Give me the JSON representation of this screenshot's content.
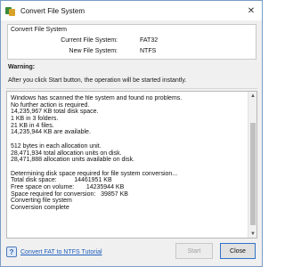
{
  "window": {
    "title": "Convert File System",
    "close_glyph": "✕"
  },
  "info_group": {
    "legend": "Convert File System",
    "rows": [
      {
        "label": "Current File System:",
        "value": "FAT32"
      },
      {
        "label": "New File System:",
        "value": "NTFS"
      }
    ]
  },
  "warning": {
    "title": "Warning:",
    "text": "After you click Start button, the operation will be started instantly."
  },
  "log": {
    "lines": [
      "Windows has scanned the file system and found no problems.",
      "No further action is required.",
      "14,235,967 KB total disk space.",
      "1 KB in 3 folders.",
      "21 KB in 4 files.",
      "14,235,944 KB are available.",
      "",
      "512 bytes in each allocation unit.",
      "28,471,934 total allocation units on disk.",
      "28,471,888 allocation units available on disk.",
      "",
      "Determining disk space required for file system conversion...",
      "Total disk space:          14461951 KB",
      "Free space on volume:       14235944 KB",
      "Space required for conversion:   39857 KB",
      "Converting file system",
      "Conversion complete"
    ]
  },
  "footer": {
    "link_text": "Convert FAT to NTFS Tutorial",
    "start_label": "Start",
    "close_label": "Close"
  }
}
